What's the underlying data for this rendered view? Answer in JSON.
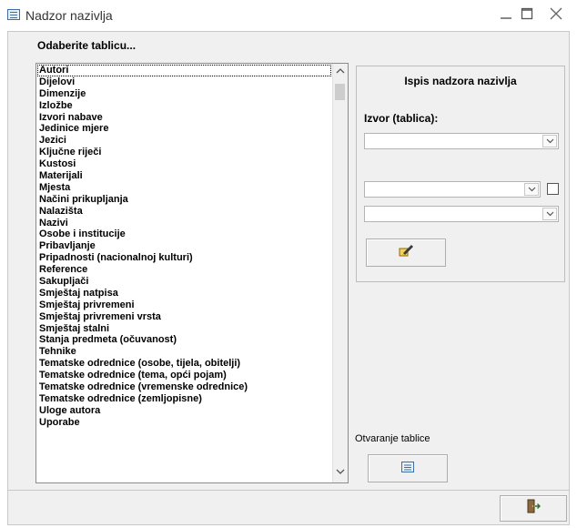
{
  "window": {
    "title": "Nadzor nazivlja",
    "app_icon": "form-icon",
    "controls": [
      "minimize-icon",
      "maximize-icon",
      "close-icon"
    ]
  },
  "left": {
    "label": "Odaberite tablicu...",
    "selected_index": 0,
    "items": [
      "Autori",
      "Dijelovi",
      "Dimenzije",
      "Izložbe",
      "Izvori nabave",
      "Jedinice mjere",
      "Jezici",
      "Ključne riječi",
      "Kustosi",
      "Materijali",
      "Mjesta",
      "Načini prikupljanja",
      "Nalazišta",
      "Nazivi",
      "Osobe i institucije",
      "Pribavljanje",
      "Pripadnosti (nacionalnoj kulturi)",
      "Reference",
      "Sakupljači",
      "Smještaj natpisa",
      "Smještaj privremeni",
      "Smještaj privremeni vrsta",
      "Smještaj stalni",
      "Stanja predmeta (očuvanost)",
      "Tehnike",
      "Tematske odrednice (osobe, tijela, obitelji)",
      "Tematske odrednice (tema, opći pojam)",
      "Tematske odrednice (vremenske odrednice)",
      "Tematske odrednice (zemljopisne)",
      "Uloge autora",
      "Uporabe"
    ]
  },
  "right": {
    "panel_title": "Ispis nadzora nazivlja",
    "source_label": "Izvor (tablica):",
    "source_value": "",
    "combo2_value": "",
    "combo3_value": "",
    "checkbox_checked": false,
    "edit_button_icon": "pencil-edit-icon"
  },
  "open_table": {
    "label": "Otvaranje tablice",
    "button_icon": "form-icon"
  },
  "footer": {
    "exit_icon": "exit-door-icon"
  }
}
